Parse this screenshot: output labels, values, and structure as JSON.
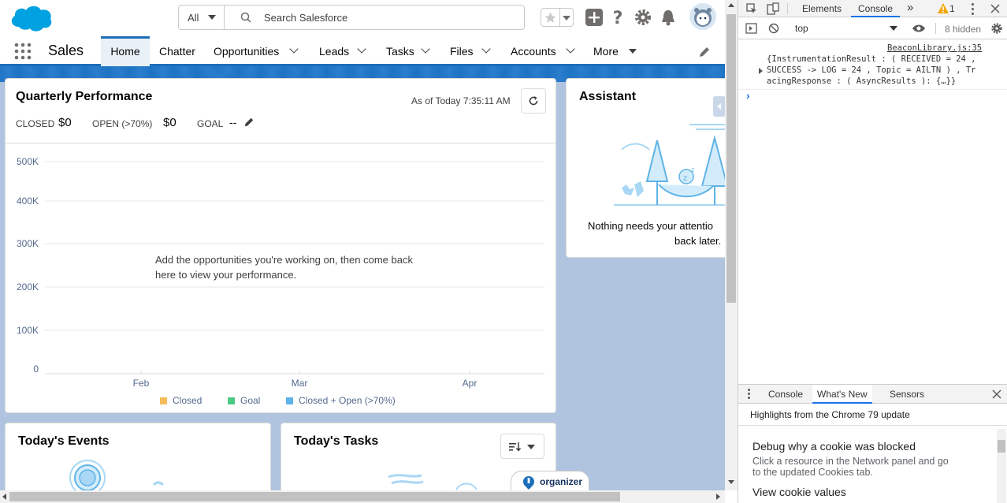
{
  "header": {
    "search": {
      "scope": "All",
      "placeholder": "Search Salesforce"
    }
  },
  "nav": {
    "app_name": "Sales",
    "items": [
      {
        "label": "Home"
      },
      {
        "label": "Chatter"
      },
      {
        "label": "Opportunities"
      },
      {
        "label": "Leads"
      },
      {
        "label": "Tasks"
      },
      {
        "label": "Files"
      },
      {
        "label": "Accounts"
      },
      {
        "label": "More"
      }
    ]
  },
  "performance": {
    "title": "Quarterly Performance",
    "as_of": "As of Today 7:35:11 AM",
    "closed_label": "CLOSED",
    "closed_value": "$0",
    "open_label": "OPEN (>70%)",
    "open_value": "$0",
    "goal_label": "GOAL",
    "goal_value": "--",
    "empty_message": "Add the opportunities you're working on, then come back here to view your performance."
  },
  "chart_data": {
    "type": "line",
    "title": "",
    "x": [
      "Feb",
      "Mar",
      "Apr"
    ],
    "y_ticks": [
      "500K",
      "400K",
      "300K",
      "200K",
      "100K",
      "0"
    ],
    "ylim": [
      0,
      500000
    ],
    "series": [
      {
        "name": "Closed",
        "color": "#f4bc59",
        "values": []
      },
      {
        "name": "Goal",
        "color": "#4bca81",
        "values": []
      },
      {
        "name": "Closed + Open (>70%)",
        "color": "#5eb4e8",
        "values": []
      }
    ],
    "legend_position": "bottom",
    "grid": true
  },
  "assistant": {
    "title": "Assistant",
    "message_line1": "Nothing needs your attentio",
    "message_line2": "back later."
  },
  "events": {
    "title": "Today's Events"
  },
  "tasks": {
    "title": "Today's Tasks"
  },
  "organizer": {
    "label": "organizer"
  },
  "devtools": {
    "tabs": {
      "elements": "Elements",
      "console": "Console",
      "more": "»",
      "warning_count": "1"
    },
    "toolbar": {
      "context": "top",
      "hidden": "8 hidden"
    },
    "log": {
      "source": "BeaconLibrary.js:35",
      "line1": "{InstrumentationResult :  ( RECEIVED = 24 ,",
      "line2": "SUCCESS -> LOG = 24 , Topic = AILTN )  , Tr",
      "line3": "acingResponse : ( AsyncResults ): {…}}",
      "prompt": "›"
    },
    "drawer": {
      "tabs": [
        "Console",
        "What's New",
        "Sensors"
      ],
      "highlight": "Highlights from the Chrome 79 update",
      "item1_title": "Debug why a cookie was blocked",
      "item1_desc_line1": "Click a resource in the Network panel and go",
      "item1_desc_line2": "to the updated Cookies tab.",
      "item2_title": "View cookie values"
    }
  },
  "colors": {
    "brand_blue": "#1b6fb8",
    "cloud_blue": "#00a1e0",
    "closed": "#f4bc59",
    "goal": "#4bca81",
    "open": "#5eb4e8"
  }
}
